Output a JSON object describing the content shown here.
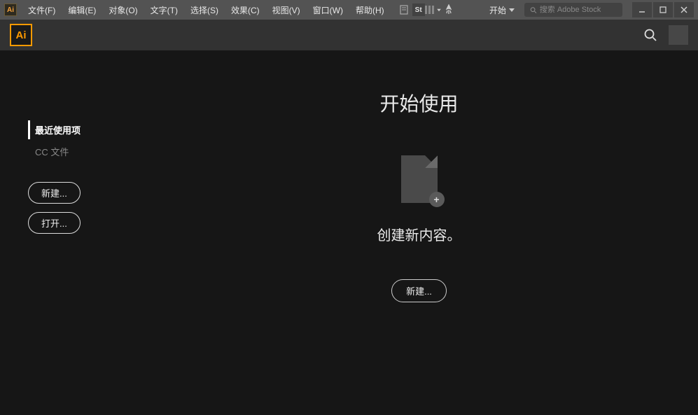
{
  "app": {
    "short_name": "Ai"
  },
  "menubar": {
    "items": [
      "文件(F)",
      "编辑(E)",
      "对象(O)",
      "文字(T)",
      "选择(S)",
      "效果(C)",
      "视图(V)",
      "窗口(W)",
      "帮助(H)"
    ],
    "st_icon_label": "St",
    "workspace_label": "开始",
    "search_placeholder": "搜索 Adobe Stock"
  },
  "sidebar": {
    "recent_label": "最近使用项",
    "cc_files_label": "CC 文件",
    "new_btn": "新建...",
    "open_btn": "打开..."
  },
  "main": {
    "title": "开始使用",
    "subtitle": "创建新内容。",
    "new_btn": "新建...",
    "plus_symbol": "+"
  }
}
